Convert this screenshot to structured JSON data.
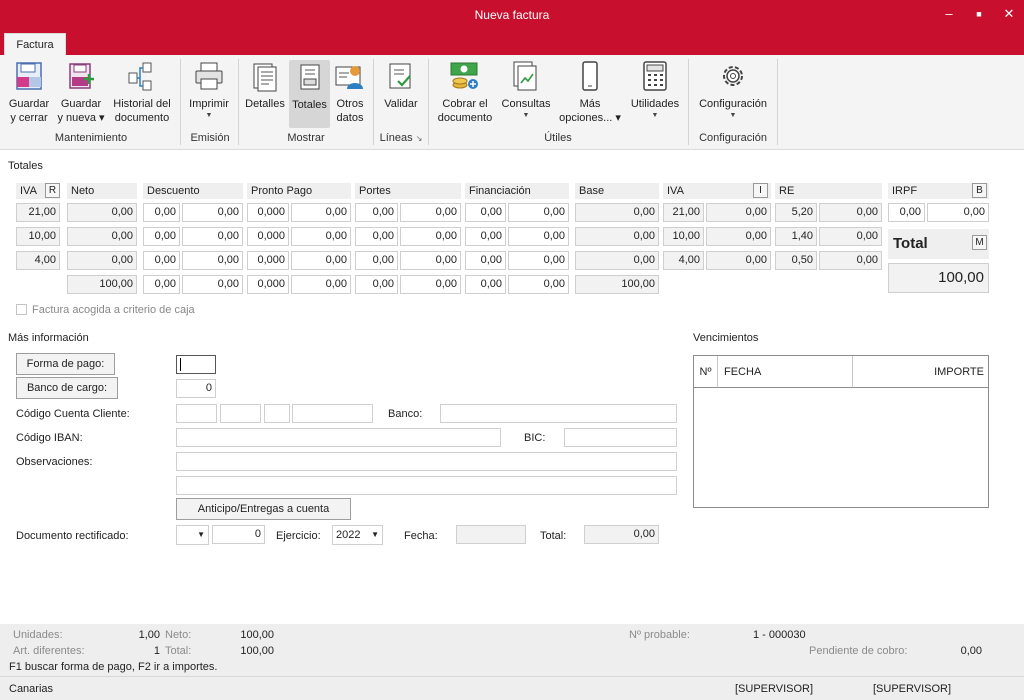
{
  "window": {
    "title": "Nueva factura",
    "minimize": "–",
    "maximize": "■",
    "close": "✕"
  },
  "tabs": [
    {
      "label": "Factura"
    }
  ],
  "ribbon": {
    "buttons": {
      "guardar_cerrar": [
        "Guardar",
        "y cerrar"
      ],
      "guardar_nueva": [
        "Guardar",
        "y nueva ▾"
      ],
      "historial": [
        "Historial del",
        "documento"
      ],
      "imprimir": [
        "Imprimir"
      ],
      "detalles": [
        "Detalles"
      ],
      "totales": [
        "Totales"
      ],
      "otros_datos": [
        "Otros",
        "datos"
      ],
      "validar": [
        "Validar"
      ],
      "cobrar": [
        "Cobrar el",
        "documento"
      ],
      "consultas": [
        "Consultas"
      ],
      "mas_opciones": [
        "Más",
        "opciones... ▾"
      ],
      "utilidades": [
        "Utilidades"
      ],
      "configuracion": [
        "Configuración"
      ]
    },
    "groups": {
      "mantenimiento": "Mantenimiento",
      "emision": "Emisión",
      "mostrar": "Mostrar",
      "lineas": "Líneas",
      "utiles": "Útiles",
      "configuracion": "Configuración"
    }
  },
  "totales": {
    "section_title": "Totales",
    "headers": {
      "iva": "IVA",
      "iva_btn": "R",
      "neto": "Neto",
      "descuento": "Descuento",
      "pronto_pago": "Pronto Pago",
      "portes": "Portes",
      "financiacion": "Financiación",
      "base": "Base",
      "iva2": "IVA",
      "iva2_btn": "I",
      "re": "RE",
      "irpf": "IRPF",
      "irpf_btn": "B"
    },
    "rows": [
      [
        "21,00",
        "0,00",
        "0,00",
        "0,00",
        "0,000",
        "0,00",
        "0,00",
        "0,00",
        "0,00",
        "0,00",
        "0,00",
        "21,00",
        "0,00",
        "5,20",
        "0,00"
      ],
      [
        "10,00",
        "0,00",
        "0,00",
        "0,00",
        "0,000",
        "0,00",
        "0,00",
        "0,00",
        "0,00",
        "0,00",
        "0,00",
        "10,00",
        "0,00",
        "1,40",
        "0,00"
      ],
      [
        "4,00",
        "0,00",
        "0,00",
        "0,00",
        "0,000",
        "0,00",
        "0,00",
        "0,00",
        "0,00",
        "0,00",
        "0,00",
        "4,00",
        "0,00",
        "0,50",
        "0,00"
      ],
      [
        "",
        "100,00",
        "0,00",
        "0,00",
        "0,000",
        "0,00",
        "0,00",
        "0,00",
        "0,00",
        "0,00",
        "100,00",
        "",
        "",
        "",
        ""
      ]
    ],
    "irpf_values": [
      "0,00",
      "0,00"
    ],
    "total_label": "Total",
    "total_btn": "M",
    "total_value": "100,00",
    "criterio_caja": "Factura acogida a criterio de caja"
  },
  "mas_info": {
    "title": "Más información",
    "forma_pago_btn": "Forma de pago:",
    "forma_pago_value": "",
    "banco_cargo_btn": "Banco de cargo:",
    "banco_cargo_value": "0",
    "codigo_cuenta_label": "Código Cuenta Cliente:",
    "banco_label": "Banco:",
    "iban_label": "Código IBAN:",
    "bic_label": "BIC:",
    "observaciones_label": "Observaciones:",
    "anticipo_btn": "Anticipo/Entregas a cuenta",
    "doc_rectificado_label": "Documento rectificado:",
    "doc_rectificado_num": "0",
    "ejercicio_label": "Ejercicio:",
    "ejercicio_value": "2022",
    "fecha_label": "Fecha:",
    "total_label": "Total:",
    "total_value": "0,00"
  },
  "vencimientos": {
    "title": "Vencimientos",
    "col_num": "Nº",
    "col_fecha": "FECHA",
    "col_importe": "IMPORTE"
  },
  "footer": {
    "unidades_label": "Unidades:",
    "unidades_value": "1,00",
    "neto_label": "Neto:",
    "neto_value": "100,00",
    "art_label": "Art. diferentes:",
    "art_value": "1",
    "total_label": "Total:",
    "total_value": "100,00",
    "n_probable_label": "Nº probable:",
    "n_probable_value": "1 - 000030",
    "pendiente_label": "Pendiente de cobro:",
    "pendiente_value": "0,00",
    "hint": "F1 buscar forma de pago, F2 ir a importes.",
    "region": "Canarias",
    "user1": "[SUPERVISOR]",
    "user2": "[SUPERVISOR]"
  }
}
